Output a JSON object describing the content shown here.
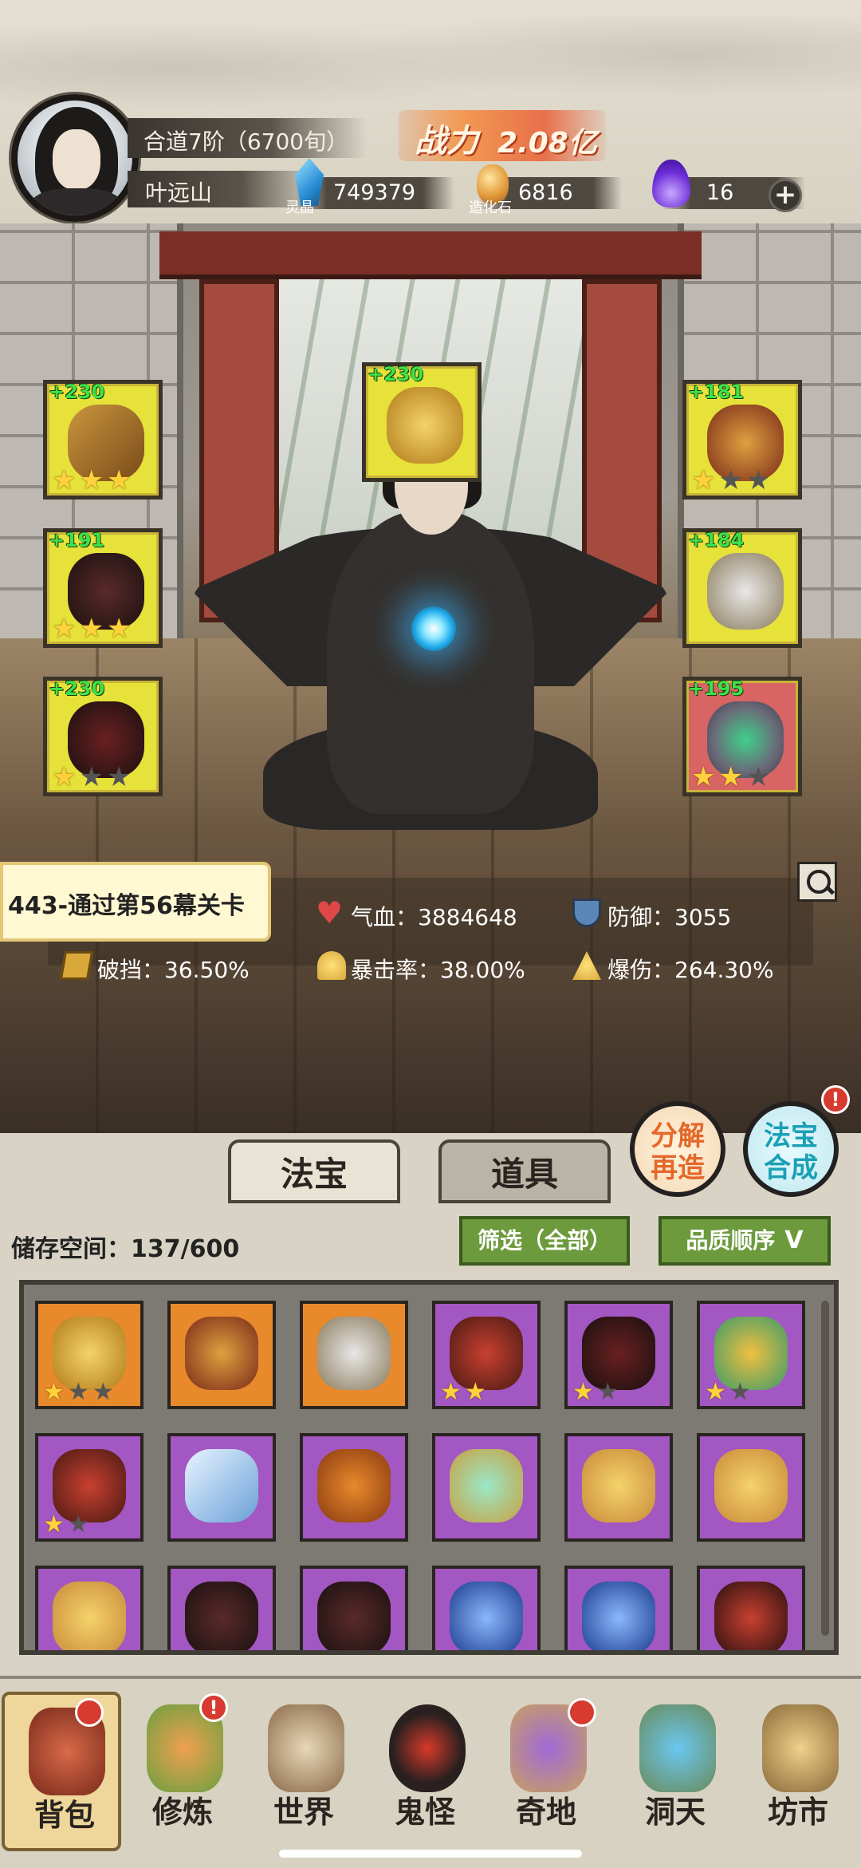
{
  "player": {
    "realm": "合道7阶（6700旬）",
    "name": "叶远山"
  },
  "power": {
    "label": "战力",
    "value": "2.08亿"
  },
  "resources": [
    {
      "icon": "crystal-icon",
      "sub": "灵晶",
      "value": "749379"
    },
    {
      "icon": "stone-icon",
      "sub": "造化石",
      "value": "6816"
    },
    {
      "icon": "purple-flame-icon",
      "sub": "",
      "value": "16"
    }
  ],
  "equipment": [
    {
      "slot": "weapon",
      "level": "+230",
      "stars": 3,
      "max_stars": 3
    },
    {
      "slot": "talisman",
      "level": "+230",
      "stars": 0,
      "max_stars": 0
    },
    {
      "slot": "crown",
      "level": "+181",
      "stars": 1,
      "max_stars": 3
    },
    {
      "slot": "armor",
      "level": "+191",
      "stars": 3,
      "max_stars": 3
    },
    {
      "slot": "pendant",
      "level": "+184",
      "stars": 0,
      "max_stars": 0
    },
    {
      "slot": "boots",
      "level": "+230",
      "stars": 1,
      "max_stars": 3
    },
    {
      "slot": "ring",
      "level": "+195",
      "stars": 2,
      "max_stars": 3
    }
  ],
  "stage": "443-通过第56幕关卡",
  "stats": {
    "hp": "气血：3884648",
    "defense": "防御：3055",
    "block": "破挡：36.50%",
    "crit_rate": "暴击率：38.00%",
    "crit_damage": "爆伤：264.30%"
  },
  "tabs": {
    "treasure": "法宝",
    "items": "道具"
  },
  "actions": {
    "decompose_line1": "分解",
    "decompose_line2": "再造",
    "synthesize_line1": "法宝",
    "synthesize_line2": "合成",
    "synthesize_badge": "!"
  },
  "storage": "储存空间：137/600",
  "filter": {
    "label": "筛选（全部）",
    "sort": "品质顺序"
  },
  "inventory": [
    {
      "quality": "orange",
      "stars": 1,
      "max_stars": 3
    },
    {
      "quality": "orange",
      "stars": 0,
      "max_stars": 0
    },
    {
      "quality": "orange",
      "stars": 0,
      "max_stars": 0
    },
    {
      "quality": "purple",
      "stars": 2,
      "max_stars": 2
    },
    {
      "quality": "purple",
      "stars": 1,
      "max_stars": 2
    },
    {
      "quality": "purple",
      "stars": 1,
      "max_stars": 2
    },
    {
      "quality": "purple",
      "stars": 1,
      "max_stars": 2
    },
    {
      "quality": "purple",
      "stars": 0,
      "max_stars": 0
    },
    {
      "quality": "purple",
      "stars": 0,
      "max_stars": 0
    },
    {
      "quality": "purple",
      "stars": 0,
      "max_stars": 0
    },
    {
      "quality": "purple",
      "stars": 0,
      "max_stars": 0
    },
    {
      "quality": "purple",
      "stars": 0,
      "max_stars": 0
    },
    {
      "quality": "purple",
      "stars": 0,
      "max_stars": 0
    },
    {
      "quality": "purple",
      "stars": 0,
      "max_stars": 0
    },
    {
      "quality": "purple",
      "stars": 0,
      "max_stars": 0
    },
    {
      "quality": "purple",
      "stars": 0,
      "max_stars": 0
    },
    {
      "quality": "purple",
      "stars": 0,
      "max_stars": 0
    },
    {
      "quality": "purple",
      "stars": 0,
      "max_stars": 0
    }
  ],
  "nav": [
    {
      "label": "背包",
      "icon": "bag-icon",
      "badge": false
    },
    {
      "label": "修炼",
      "icon": "lotus-icon",
      "badge": true
    },
    {
      "label": "世界",
      "icon": "scroll-map-icon",
      "badge": false
    },
    {
      "label": "鬼怪",
      "icon": "demon-egg-icon",
      "badge": false
    },
    {
      "label": "奇地",
      "icon": "pagoda-icon",
      "badge": true
    },
    {
      "label": "洞天",
      "icon": "portal-icon",
      "badge": false
    },
    {
      "label": "坊市",
      "icon": "market-icon",
      "badge": false
    }
  ]
}
